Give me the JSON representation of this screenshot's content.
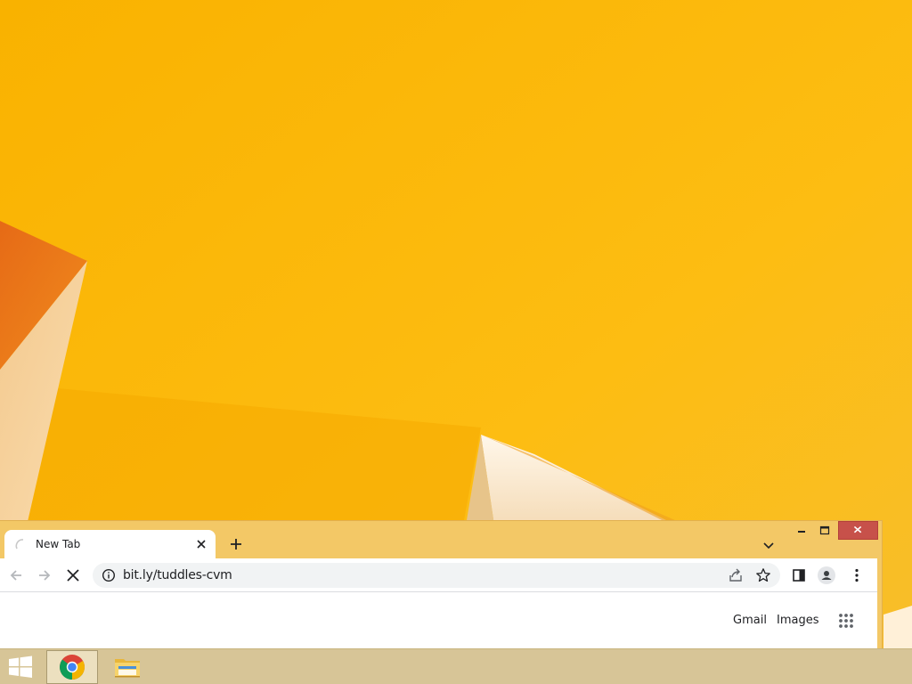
{
  "desktop": {
    "wallpaper": "yellow-orange-abstract",
    "colors": {
      "base": "#f7b400",
      "accent": "#e8781e",
      "highlight": "#fff4e0"
    }
  },
  "browser": {
    "tab": {
      "title": "New Tab",
      "favicon": "loading-spinner-icon",
      "close_icon": "close-icon"
    },
    "new_tab_icon": "plus-icon",
    "tab_search_icon": "chevron-down-icon",
    "window_controls": {
      "minimize": "minimize-icon",
      "maximize": "maximize-icon",
      "close": "close-icon"
    },
    "toolbar": {
      "back_icon": "arrow-left-icon",
      "forward_icon": "arrow-right-icon",
      "stop_icon": "stop-icon",
      "url": "bit.ly/tuddles-cvm",
      "site_info_icon": "info-icon",
      "share_icon": "share-icon",
      "bookmark_icon": "star-icon",
      "side_panel_icon": "side-panel-icon",
      "profile_icon": "person-icon",
      "menu_icon": "kebab-menu-icon"
    },
    "page": {
      "gmail_label": "Gmail",
      "images_label": "Images",
      "apps_icon": "apps-grid-icon"
    },
    "colors": {
      "frame": "#f3c866",
      "close_button": "#c7514a",
      "toolbar": "#ffffff",
      "omnibox": "#f1f3f4"
    }
  },
  "taskbar": {
    "start_icon": "windows-logo-icon",
    "pinned": [
      {
        "app": "chrome",
        "icon": "chrome-icon",
        "active": true
      },
      {
        "app": "file-explorer",
        "icon": "folder-icon",
        "active": false
      }
    ],
    "color": "#d7c597"
  }
}
